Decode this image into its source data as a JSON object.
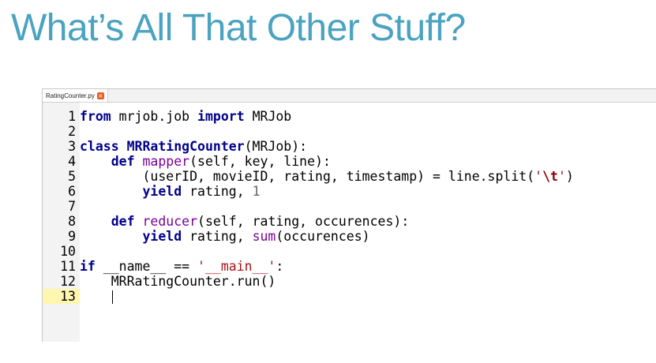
{
  "slide": {
    "title": "What’s All That Other Stuff?"
  },
  "editor": {
    "tab": {
      "label": "RatingCounter.py",
      "close_glyph": "×",
      "close_icon": "close-icon"
    },
    "lines": [
      {
        "num": "1",
        "t1": "from",
        "t2": " mrjob.job ",
        "t3": "import",
        "t4": " MRJob"
      },
      {
        "num": "2"
      },
      {
        "num": "3",
        "t1": "class",
        "t2": " ",
        "t3": "MRRatingCounter",
        "t4": "(MRJob):"
      },
      {
        "num": "4",
        "t1": "    ",
        "t2": "def",
        "t3": " ",
        "t4": "mapper",
        "t5": "(self, key, line):"
      },
      {
        "num": "5",
        "t1": "        (userID, movieID, rating, timestamp) = line.split(",
        "t2": "'",
        "t3": "\\t",
        "t4": "'",
        "t5": ")"
      },
      {
        "num": "6",
        "t1": "        ",
        "t2": "yield",
        "t3": " rating, ",
        "t4": "1"
      },
      {
        "num": "7"
      },
      {
        "num": "8",
        "t1": "    ",
        "t2": "def",
        "t3": " ",
        "t4": "reducer",
        "t5": "(self, rating, occurences):"
      },
      {
        "num": "9",
        "t1": "        ",
        "t2": "yield",
        "t3": " rating, ",
        "t4": "sum",
        "t5": "(occurences)"
      },
      {
        "num": "10"
      },
      {
        "num": "11",
        "t1": "if",
        "t2": " __name__ == ",
        "t3": "'__main__'",
        "t4": ":"
      },
      {
        "num": "12",
        "t1": "    MRRatingCounter.run()"
      },
      {
        "num": "13"
      }
    ]
  }
}
